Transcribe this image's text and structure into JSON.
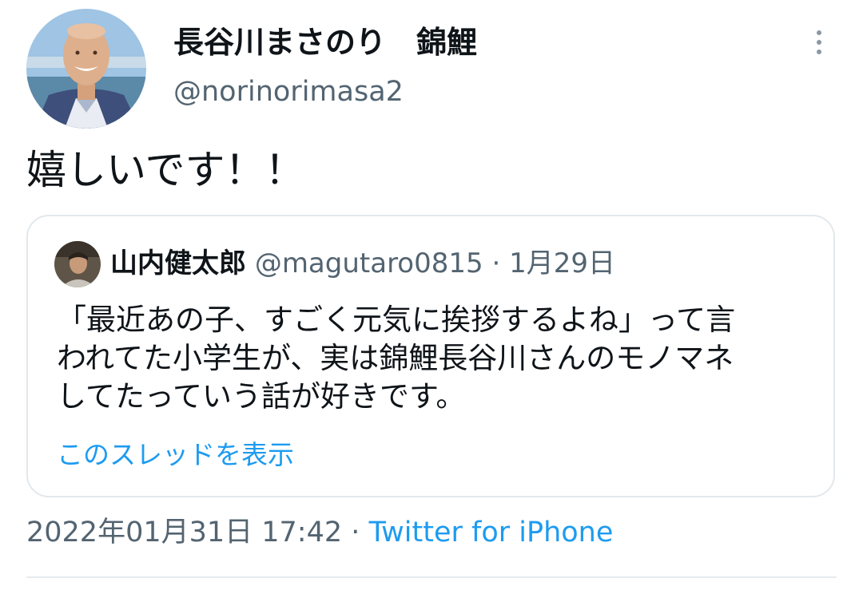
{
  "tweet": {
    "author": {
      "display_name": "長谷川まさのり　錦鯉",
      "handle": "@norinorimasa2",
      "avatar": "avatar-photo"
    },
    "more_icon": "more-vertical-icon",
    "text": "嬉しいです！！",
    "quoted": {
      "author_name": "山内健太郎",
      "author_handle": "@magutaro0815",
      "separator": "·",
      "date": "1月29日",
      "avatar": "avatar-photo",
      "text": "「最近あの子、すごく元気に挨拶するよね」って言\nわれてた小学生が、実は錦鯉長谷川さんのモノマネ\nしてたっていう話が好きです。",
      "show_thread": "このスレッドを表示"
    },
    "timestamp": "2022年01月31日 17:42",
    "meta_separator": "·",
    "source": "Twitter for iPhone"
  },
  "colors": {
    "text_primary": "#0f1419",
    "text_secondary": "#536471",
    "link": "#1d9bf0",
    "border": "#e3e8ec"
  }
}
